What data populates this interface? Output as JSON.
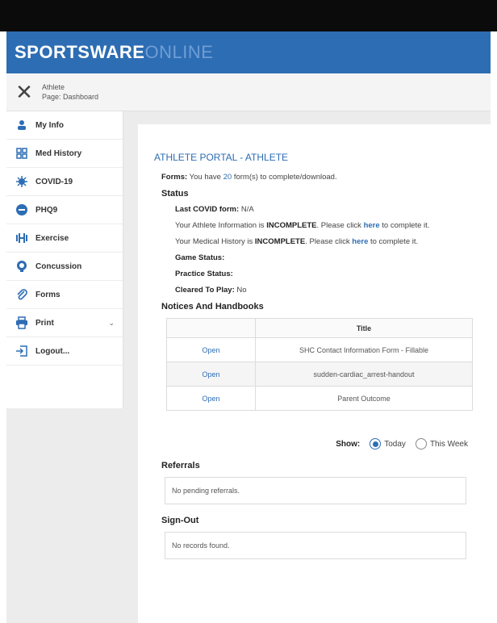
{
  "brand": {
    "strong": "SPORTSWARE",
    "light": "ONLINE"
  },
  "context": {
    "line1": "Athlete",
    "line2": "Page: Dashboard"
  },
  "sidebar": {
    "items": [
      {
        "label": "My Info",
        "icon": "person-icon"
      },
      {
        "label": "Med History",
        "icon": "grid-icon"
      },
      {
        "label": "COVID-19",
        "icon": "virus-icon"
      },
      {
        "label": "PHQ9",
        "icon": "dots-icon"
      },
      {
        "label": "Exercise",
        "icon": "dumbbell-icon"
      },
      {
        "label": "Concussion",
        "icon": "brain-icon"
      },
      {
        "label": "Forms",
        "icon": "paperclip-icon"
      },
      {
        "label": "Print",
        "icon": "printer-icon"
      },
      {
        "label": "Logout...",
        "icon": "logout-icon"
      }
    ]
  },
  "main": {
    "title": "ATHLETE PORTAL - ATHLETE",
    "forms": {
      "label": "Forms:",
      "prefix": "You have",
      "count": "20",
      "suffix": "form(s) to complete/download."
    },
    "status_heading": "Status",
    "last_covid": {
      "label": "Last COVID form:",
      "value": "N/A"
    },
    "athlete_info": {
      "prefix": "Your Athlete Information is",
      "state": "INCOMPLETE",
      "mid": ". Please click",
      "link": "here",
      "suffix": "to complete it."
    },
    "med_history": {
      "prefix": "Your Medical History is",
      "state": "INCOMPLETE",
      "mid": ". Please click",
      "link": "here",
      "suffix": "to complete it."
    },
    "game_status": {
      "label": "Game Status:",
      "value": ""
    },
    "practice_status": {
      "label": "Practice Status:",
      "value": ""
    },
    "cleared": {
      "label": "Cleared To Play:",
      "value": "No"
    },
    "notices_heading": "Notices And Handbooks",
    "notices_col_title": "Title",
    "notices": [
      {
        "action": "Open",
        "title": "SHC Contact Information Form - Fillable"
      },
      {
        "action": "Open",
        "title": "sudden-cardiac_arrest-handout"
      },
      {
        "action": "Open",
        "title": "Parent Outcome"
      }
    ],
    "show": {
      "label": "Show:",
      "option1": "Today",
      "option2": "This Week"
    },
    "referrals": {
      "heading": "Referrals",
      "empty": "No pending referrals."
    },
    "signout": {
      "heading": "Sign-Out",
      "empty": "No records found."
    }
  },
  "colors": {
    "brand": "#2d6db3",
    "top_bar": "#0b0b0b",
    "background": "#ececec"
  }
}
